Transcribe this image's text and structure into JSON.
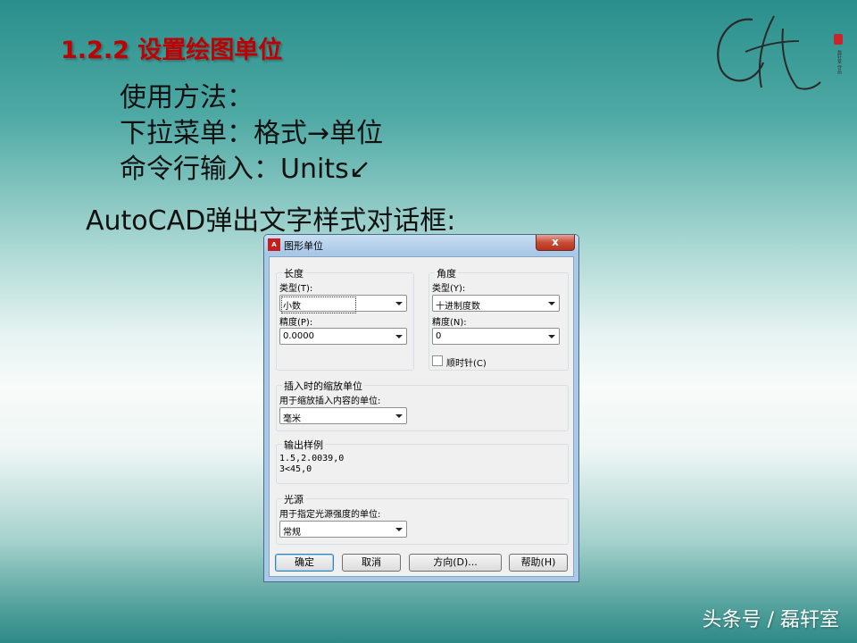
{
  "slide": {
    "title": "1.2.2 设置绘图单位",
    "bullets": [
      "使用方法：",
      "下拉菜单：格式→单位",
      "命令行输入：Units↙"
    ],
    "intro": "AutoCAD弹出文字样式对话框:",
    "watermark": "头条号 / 磊轩室",
    "seal_text": "磊轩室 作品"
  },
  "dialog": {
    "title": "图形单位",
    "icon_text": "A",
    "close_label": "x",
    "length": {
      "legend": "长度",
      "type_label": "类型(T):",
      "type_value": "小数",
      "precision_label": "精度(P):",
      "precision_value": "0.0000"
    },
    "angle": {
      "legend": "角度",
      "type_label": "类型(Y):",
      "type_value": "十进制度数",
      "precision_label": "精度(N):",
      "precision_value": "0",
      "clockwise_label": "顺时针(C)"
    },
    "insert": {
      "legend": "插入时的缩放单位",
      "desc": "用于缩放插入内容的单位:",
      "value": "毫米"
    },
    "output": {
      "legend": "输出样例",
      "line1": "1.5,2.0039,0",
      "line2": "3<45,0"
    },
    "light": {
      "legend": "光源",
      "desc": "用于指定光源强度的单位:",
      "value": "常规"
    },
    "buttons": {
      "ok": "确定",
      "cancel": "取消",
      "direction": "方向(D)...",
      "help": "帮助(H)"
    }
  }
}
